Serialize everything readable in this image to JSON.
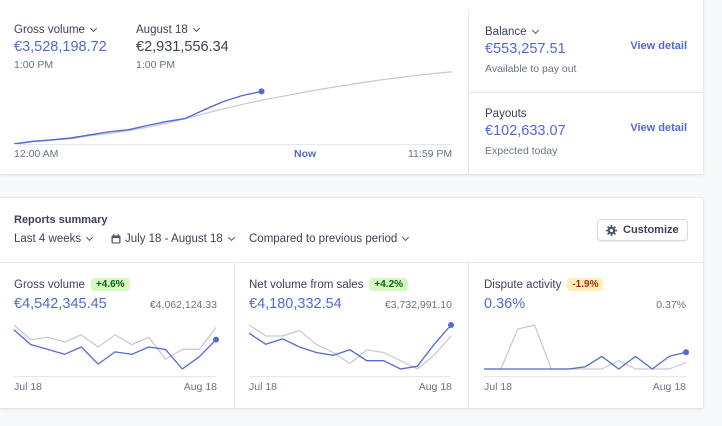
{
  "today": {
    "gross": {
      "label": "Gross volume",
      "value": "€3,528,198.72",
      "time": "1:00 PM"
    },
    "compare": {
      "label": "August 18",
      "value": "€2,931,556.34",
      "time": "1:00 PM"
    },
    "axis": {
      "start": "12:00 AM",
      "now": "Now",
      "end": "11:59 PM"
    },
    "chart_data": {
      "type": "line",
      "title": "",
      "x": [
        0,
        1,
        2,
        3,
        4,
        5,
        6,
        7,
        8,
        9,
        10,
        11,
        12,
        13,
        14,
        15,
        16,
        17,
        18,
        19,
        20,
        21,
        22,
        23
      ],
      "series": [
        {
          "name": "Gross volume",
          "values": [
            0,
            0.18,
            0.28,
            0.4,
            0.62,
            0.82,
            0.95,
            1.24,
            1.5,
            1.72,
            2.3,
            2.85,
            3.25,
            3.53,
            null,
            null,
            null,
            null,
            null,
            null,
            null,
            null,
            null,
            null
          ]
        },
        {
          "name": "August 18",
          "values": [
            0,
            0.15,
            0.25,
            0.36,
            0.55,
            0.7,
            0.9,
            1.12,
            1.38,
            1.7,
            2.03,
            2.36,
            2.66,
            2.93,
            3.17,
            3.42,
            3.65,
            3.86,
            4.06,
            4.25,
            4.42,
            4.58,
            4.72,
            4.84
          ]
        }
      ],
      "colors": {
        "current": "#5469d4",
        "previous": "#c1c9d2"
      }
    }
  },
  "balance": {
    "label": "Balance",
    "value": "€553,257.51",
    "sub": "Available to pay out",
    "link": "View detail"
  },
  "payouts": {
    "label": "Payouts",
    "value": "€102,633.07",
    "sub": "Expected today",
    "link": "View detail"
  },
  "reports": {
    "title": "Reports summary",
    "range": "Last 4 weeks",
    "dates": "July 18 - August 18",
    "compare": "Compared to previous period",
    "customize": "Customize"
  },
  "metrics": [
    {
      "label": "Gross volume",
      "change": "+4.6%",
      "value": "€4,542,345.45",
      "prev": "€4,062,124.33",
      "start": "Jul 18",
      "end": "Aug 18",
      "chart_data": {
        "type": "line",
        "series": [
          {
            "name": "Gross volume",
            "values": [
              5.0,
              4.4,
              4.2,
              4.0,
              4.3,
              3.6,
              4.1,
              4.0,
              4.3,
              4.2,
              3.4,
              3.9,
              4.6
            ]
          },
          {
            "name": "€4,062,124.33",
            "values": [
              5.2,
              4.6,
              4.7,
              4.5,
              4.8,
              4.3,
              4.8,
              4.4,
              4.7,
              3.8,
              4.2,
              4.2,
              5.1
            ]
          }
        ]
      }
    },
    {
      "label": "Net volume from sales",
      "change": "+4.2%",
      "value": "€4,180,332.54",
      "prev": "€3,732,991.10",
      "start": "Jul 18",
      "end": "Aug 18",
      "chart_data": {
        "type": "line",
        "series": [
          {
            "name": "Net volume from sales",
            "values": [
              4.7,
              4.3,
              4.5,
              4.2,
              4.0,
              3.9,
              4.1,
              3.7,
              3.7,
              3.4,
              3.5,
              4.3,
              5.0
            ]
          },
          {
            "name": "€3,732,991.10",
            "values": [
              5.0,
              4.6,
              4.6,
              4.8,
              4.3,
              4.0,
              3.6,
              4.1,
              4.0,
              3.7,
              3.4,
              3.9,
              4.6
            ]
          }
        ]
      }
    },
    {
      "label": "Dispute activity",
      "change": "-1.9%",
      "value": "0.36%",
      "prev": "0.37%",
      "start": "Jul 18",
      "end": "Aug 18",
      "chart_data": {
        "type": "line",
        "series": [
          {
            "name": "Dispute activity",
            "values": [
              0.2,
              0.2,
              0.2,
              0.2,
              0.2,
              0.2,
              0.22,
              0.32,
              0.2,
              0.32,
              0.2,
              0.32,
              0.36
            ]
          },
          {
            "name": "0.37%",
            "values": [
              0.2,
              0.2,
              0.58,
              0.62,
              0.2,
              0.2,
              0.2,
              0.2,
              0.28,
              0.2,
              0.2,
              0.2,
              0.26
            ]
          }
        ]
      }
    }
  ]
}
